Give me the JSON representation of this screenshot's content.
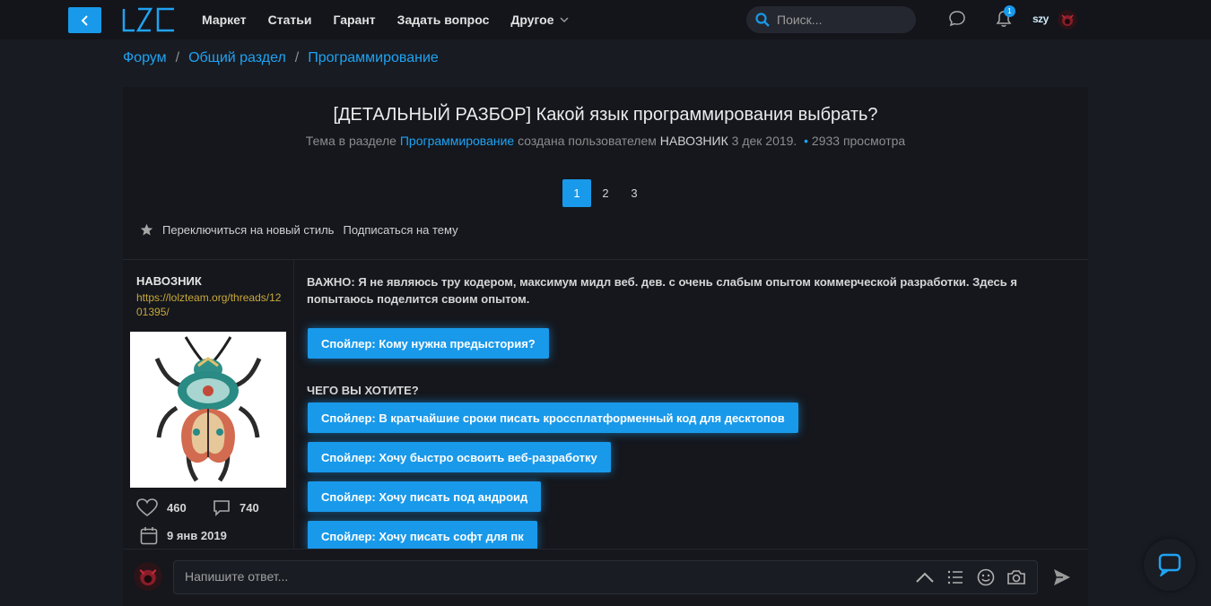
{
  "header": {
    "nav": [
      {
        "label": "Маркет"
      },
      {
        "label": "Статьи"
      },
      {
        "label": "Гарант"
      },
      {
        "label": "Задать вопрос"
      },
      {
        "label": "Другое",
        "dropdown": true
      }
    ],
    "search_placeholder": "Поиск...",
    "notifications_count": "1",
    "user_tag": "szy"
  },
  "breadcrumb": [
    "Форум",
    "Общий раздел",
    "Программирование"
  ],
  "thread": {
    "title": "[ДЕТАЛЬНЫЙ РАЗБОР] Какой язык программирования выбрать?",
    "meta_prefix": "Тема в разделе",
    "meta_section": "Программирование",
    "meta_mid": "создана пользователем",
    "meta_author": "НАВОЗНИК",
    "meta_date": "3 дек 2019.",
    "meta_views": "2933 просмотра"
  },
  "pagination": {
    "pages": [
      "1",
      "2",
      "3"
    ],
    "current": "1"
  },
  "actions": {
    "switch_style": "Переключиться на новый стиль",
    "subscribe": "Подписаться на тему"
  },
  "author": {
    "name": "НАВОЗНИК",
    "link": "https://lolzteam.org/threads/1201395/",
    "likes": "460",
    "messages": "740",
    "joined": "9 янв 2019"
  },
  "post": {
    "important_text": "ВАЖНО: Я не являюсь тру кодером, максимум мидл веб. дев. с очень слабым опытом коммерческой разработки. Здесь я попытаюсь поделится своим опытом.",
    "spoiler_intro": "Спойлер: Кому нужна предыстория?",
    "section_heading": "ЧЕГО ВЫ ХОТИТЕ?",
    "spoilers": [
      "Спойлер: В кратчайшие сроки писать кроссплатформенный код для десктопов",
      "Спойлер: Хочу быстро освоить веб-разработку",
      "Спойлер: Хочу писать под андроид",
      "Спойлер: Хочу писать софт для пк"
    ]
  },
  "reply": {
    "placeholder": "Напишите ответ..."
  },
  "colors": {
    "accent": "#1999ea",
    "background": "#181b22",
    "card": "#15171d",
    "link_gold": "#c8a838"
  }
}
